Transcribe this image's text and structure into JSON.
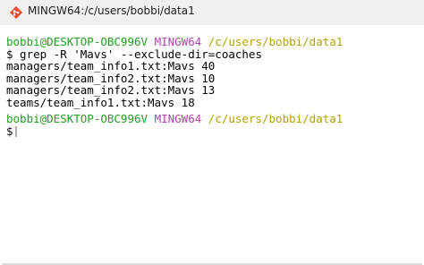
{
  "window": {
    "title": "MINGW64:/c/users/bobbi/data1",
    "icon": "git-bash-icon"
  },
  "terminal": {
    "prompt1": {
      "user_host": "bobbi@DESKTOP-OBC996V",
      "shell": "MINGW64",
      "path": "/c/users/bobbi/data1"
    },
    "command_line": "$ grep -R 'Mavs' --exclude-dir=coaches",
    "output": [
      "managers/team_info1.txt:Mavs 40",
      "managers/team_info2.txt:Mavs 10",
      "managers/team_info2.txt:Mavs 13",
      "teams/team_info1.txt:Mavs 18"
    ],
    "prompt2": {
      "user_host": "bobbi@DESKTOP-OBC996V",
      "shell": "MINGW64",
      "path": "/c/users/bobbi/data1"
    },
    "input_prompt": "$",
    "colors": {
      "user_host": "#1fa01f",
      "shell": "#b23fb2",
      "path": "#b3a100"
    }
  }
}
